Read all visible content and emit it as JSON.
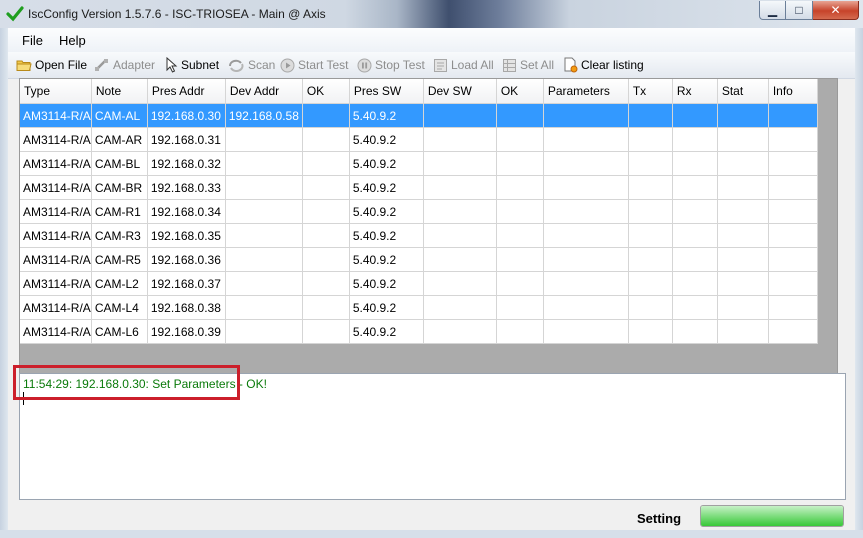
{
  "window": {
    "title": "IscConfig Version 1.5.7.6 - ISC-TRIOSEA - Main @ Axis",
    "controls": {
      "minimize": "▁",
      "maximize": "□",
      "close": "✕"
    }
  },
  "menu": {
    "items": [
      "File",
      "Help"
    ]
  },
  "toolbar": {
    "items": [
      {
        "label": "Open File",
        "icon": "open-folder-icon",
        "enabled": true
      },
      {
        "label": "Adapter",
        "icon": "network-adapter-icon",
        "enabled": false
      },
      {
        "label": "Subnet",
        "icon": "cursor-arrow-icon",
        "enabled": true
      },
      {
        "label": "Scan",
        "icon": "scan-refresh-icon",
        "enabled": false
      },
      {
        "label": "Start Test",
        "icon": "play-circle-icon",
        "enabled": false
      },
      {
        "label": "Stop Test",
        "icon": "pause-circle-icon",
        "enabled": false
      },
      {
        "label": "Load All",
        "icon": "load-all-icon",
        "enabled": false
      },
      {
        "label": "Set All",
        "icon": "set-all-icon",
        "enabled": false
      },
      {
        "label": "Clear listing",
        "icon": "clear-document-icon",
        "enabled": true
      }
    ]
  },
  "table": {
    "columns": [
      "Type",
      "Note",
      "Pres Addr",
      "Dev Addr",
      "OK",
      "Pres SW",
      "Dev SW",
      "OK",
      "Parameters",
      "Tx",
      "Rx",
      "Stat",
      "Info"
    ],
    "rows": [
      [
        "AM3114-R/A",
        "CAM-AL",
        "192.168.0.30",
        "192.168.0.58",
        "",
        "5.40.9.2",
        "",
        "",
        "",
        "",
        "",
        "",
        ""
      ],
      [
        "AM3114-R/A",
        "CAM-AR",
        "192.168.0.31",
        "",
        "",
        "5.40.9.2",
        "",
        "",
        "",
        "",
        "",
        "",
        ""
      ],
      [
        "AM3114-R/A",
        "CAM-BL",
        "192.168.0.32",
        "",
        "",
        "5.40.9.2",
        "",
        "",
        "",
        "",
        "",
        "",
        ""
      ],
      [
        "AM3114-R/A",
        "CAM-BR",
        "192.168.0.33",
        "",
        "",
        "5.40.9.2",
        "",
        "",
        "",
        "",
        "",
        "",
        ""
      ],
      [
        "AM3114-R/A",
        "CAM-R1",
        "192.168.0.34",
        "",
        "",
        "5.40.9.2",
        "",
        "",
        "",
        "",
        "",
        "",
        ""
      ],
      [
        "AM3114-R/A",
        "CAM-R3",
        "192.168.0.35",
        "",
        "",
        "5.40.9.2",
        "",
        "",
        "",
        "",
        "",
        "",
        ""
      ],
      [
        "AM3114-R/A",
        "CAM-R5",
        "192.168.0.36",
        "",
        "",
        "5.40.9.2",
        "",
        "",
        "",
        "",
        "",
        "",
        ""
      ],
      [
        "AM3114-R/A",
        "CAM-L2",
        "192.168.0.37",
        "",
        "",
        "5.40.9.2",
        "",
        "",
        "",
        "",
        "",
        "",
        ""
      ],
      [
        "AM3114-R/A",
        "CAM-L4",
        "192.168.0.38",
        "",
        "",
        "5.40.9.2",
        "",
        "",
        "",
        "",
        "",
        "",
        ""
      ],
      [
        "AM3114-R/A",
        "CAM-L6",
        "192.168.0.39",
        "",
        "",
        "5.40.9.2",
        "",
        "",
        "",
        "",
        "",
        "",
        ""
      ]
    ],
    "selected_row": 0
  },
  "log": {
    "lines": [
      "11:54:29: 192.168.0.30: Set Parameters - OK!"
    ]
  },
  "status": {
    "label": "Setting",
    "progress_percent": 100
  },
  "colors": {
    "selection": "#3399ff",
    "log_text": "#0a7a0a",
    "highlight": "#cc1f2b"
  }
}
